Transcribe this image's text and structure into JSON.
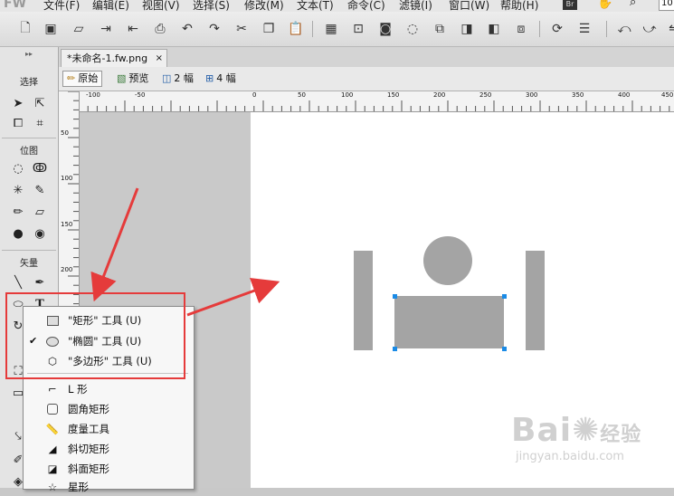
{
  "menubar": {
    "logo": "FW",
    "items": [
      "文件(F)",
      "编辑(E)",
      "视图(V)",
      "选择(S)",
      "修改(M)",
      "文本(T)",
      "命令(C)",
      "滤镜(I)",
      "窗口(W)",
      "帮助(H)"
    ],
    "bridge_label": "Br",
    "zoom_value": "10"
  },
  "document": {
    "tab_title": "*未命名-1.fw.png",
    "tab_close": "×"
  },
  "view_modes": {
    "original": "原始",
    "preview": "预览",
    "two_up": "2 幅",
    "four_up": "4 幅"
  },
  "ruler": {
    "h_labels": [
      "-100",
      "-50",
      "0",
      "50",
      "100",
      "150",
      "200",
      "250",
      "300",
      "350",
      "400",
      "450"
    ],
    "v_labels": [
      "50",
      "100",
      "150",
      "200"
    ]
  },
  "tools_panel": {
    "select_label": "选择",
    "bitmap_label": "位图",
    "vector_label": "矢量"
  },
  "flyout": {
    "items": [
      {
        "label": "\"矩形\" 工具 (U)",
        "icon": "rect-icon",
        "checked": false
      },
      {
        "label": "\"椭圆\" 工具 (U)",
        "icon": "ellipse-icon",
        "checked": true
      },
      {
        "label": "\"多边形\" 工具 (U)",
        "icon": "polygon-icon",
        "checked": false
      },
      {
        "label": "L 形",
        "icon": "l-shape-icon",
        "checked": false
      },
      {
        "label": "圆角矩形",
        "icon": "rounded-rect-icon",
        "checked": false
      },
      {
        "label": "度量工具",
        "icon": "measure-icon",
        "checked": false
      },
      {
        "label": "斜切矩形",
        "icon": "chamfer-rect-icon",
        "checked": false
      },
      {
        "label": "斜面矩形",
        "icon": "bevel-rect-icon",
        "checked": false
      },
      {
        "label": "星形",
        "icon": "star-icon",
        "checked": false
      }
    ],
    "check_mark": "✔"
  },
  "watermark": {
    "brand": "Bai",
    "brand_tail": "经验",
    "url": "jingyan.baidu.com"
  },
  "colors": {
    "selection_handle": "#1a8be6",
    "annotation_red": "#e53b3b",
    "shape_gray": "#a4a4a4"
  }
}
